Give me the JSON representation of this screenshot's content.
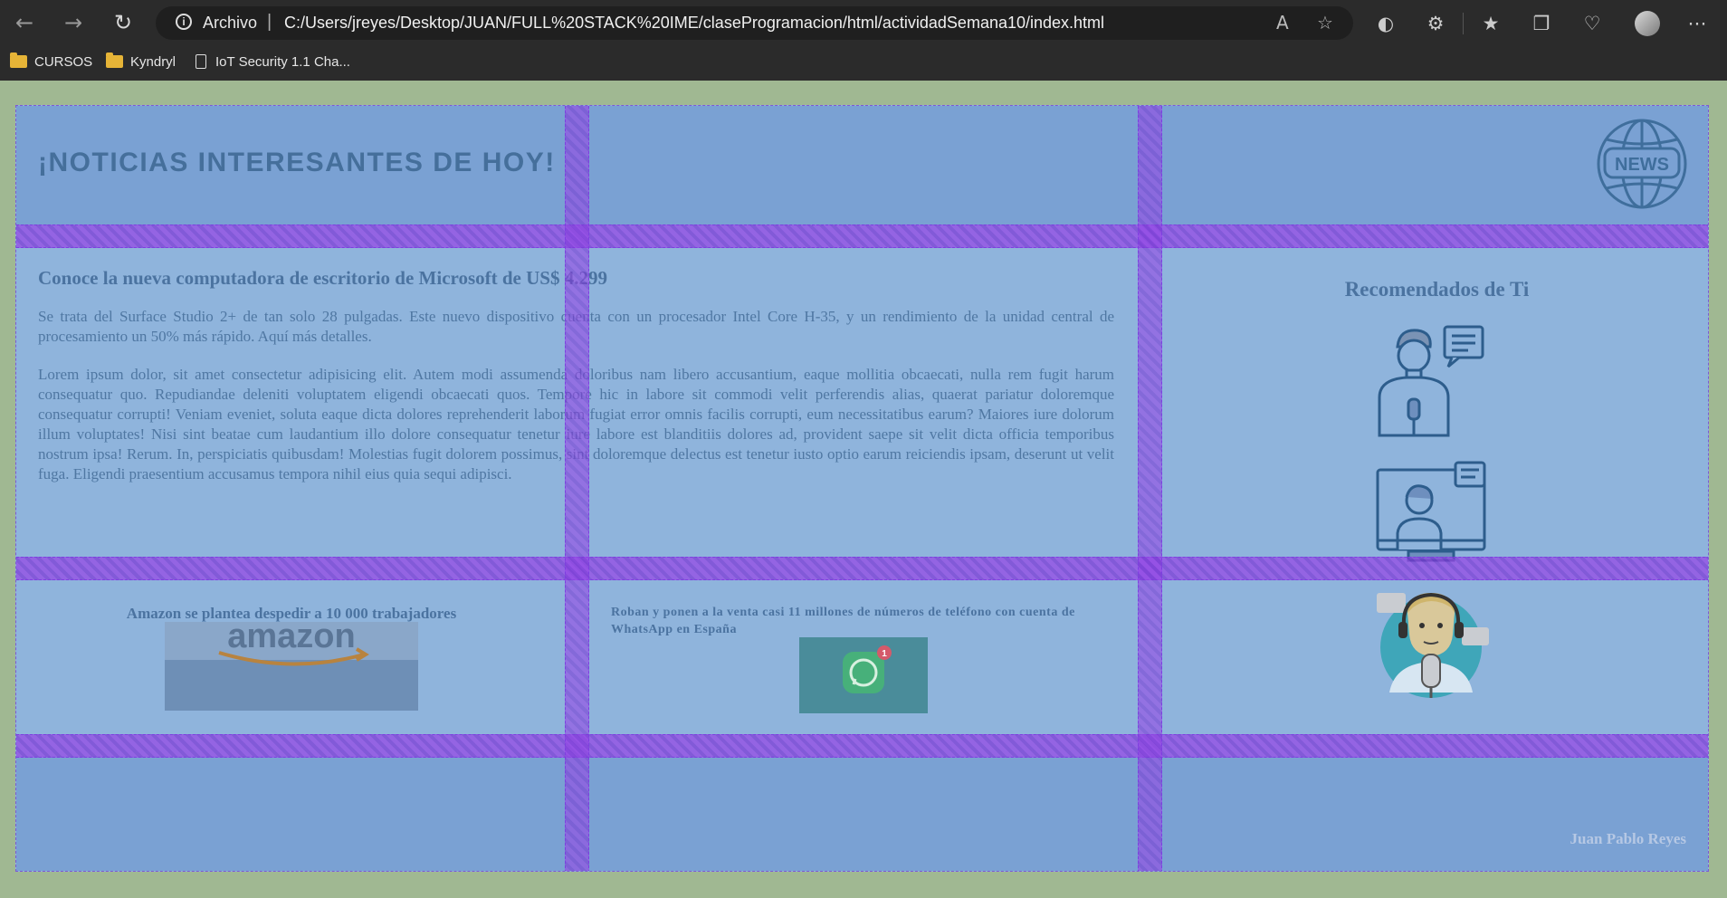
{
  "browser": {
    "back_icon": "back-arrow-icon",
    "forward_icon": "forward-arrow-icon",
    "reload_icon": "reload-icon",
    "url_scheme_label": "Archivo",
    "url": "C:/Users/jreyes/Desktop/JUAN/FULL%20STACK%20IME/claseProgramacion/html/actividadSemana10/index.html",
    "bookmarks": [
      {
        "label": "CURSOS",
        "icon": "folder-icon"
      },
      {
        "label": "Kyndryl",
        "icon": "folder-icon"
      },
      {
        "label": "IoT Security 1.1 Cha...",
        "icon": "page-icon"
      }
    ]
  },
  "page": {
    "title": "¡NOTICIAS INTERESANTES DE HOY!",
    "logo_text": "NEWS",
    "article": {
      "heading": "Conoce la nueva computadora de escritorio de Microsoft de US$ 4.299",
      "intro": "Se trata del Surface Studio 2+ de tan solo 28 pulgadas. Este nuevo dispositivo cuenta con un procesador Intel Core H-35, y un rendimiento de la unidad central de procesamiento un 50% más rápido. Aquí más detalles.",
      "body": "Lorem ipsum dolor, sit amet consectetur adipisicing elit. Autem modi assumenda doloribus nam libero accusantium, eaque mollitia obcaecati, nulla rem fugit harum consequatur quo. Repudiandae deleniti voluptatem eligendi obcaecati quos. Tempore hic in labore sit commodi velit perferendis alias, quaerat pariatur doloremque consequatur corrupti! Veniam eveniet, soluta eaque dicta dolores reprehenderit laborum fugiat error omnis facilis corrupti, eum necessitatibus earum? Maiores iure dolorum illum voluptates! Nisi sint beatae cum laudantium illo dolore consequatur tenetur iure labore est blanditiis dolores ad, provident saepe sit velit dicta officia temporibus nostrum ipsa! Rerum. In, perspiciatis quibusdam! Molestias fugit dolorem possimus, sint doloremque delectus est tenetur iusto optio earum reiciendis ipsam, deserunt ut velit fuga. Eligendi praesentium accusamus tempora nihil eius quia sequi adipisci."
    },
    "recommended_title": "Recomendados de Ti",
    "news_amazon": {
      "title": "Amazon se plantea despedir a 10 000 trabajadores",
      "logo_text": "amazon"
    },
    "news_whatsapp": {
      "title": "Roban y ponen a la venta casi 11 millones de números de teléfono con cuenta de WhatsApp en España",
      "badge": "1"
    },
    "footer_name": "Juan Pablo Reyes"
  },
  "colors": {
    "page_bg": "#a0b892",
    "cell_bg": "#8fb4dc",
    "header_bg": "#7aa1d3",
    "grid_gap": "#8a4ae0",
    "text": "#4b73a0"
  }
}
